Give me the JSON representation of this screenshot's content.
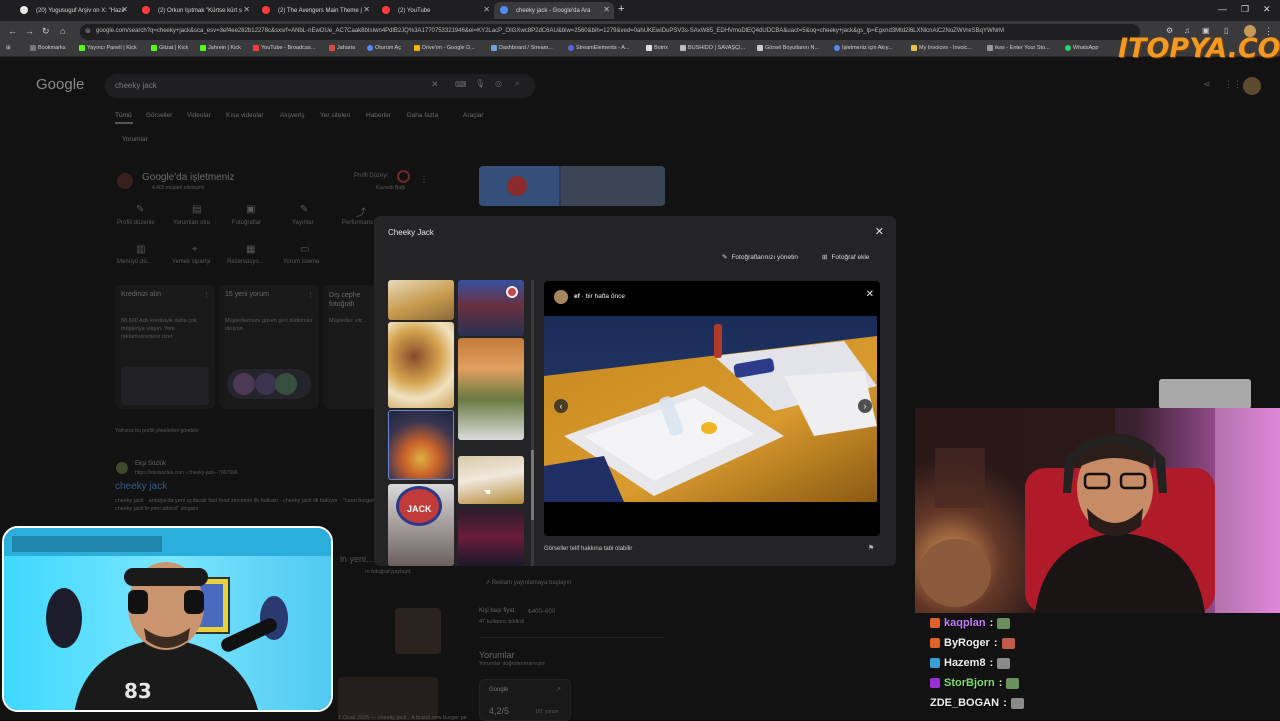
{
  "browser": {
    "tabs": [
      {
        "title": "(20) Yugusuguf Arşiv on X: \"Hazır",
        "color": "#e8e8e8"
      },
      {
        "title": "(2) Orkun Işıtmak \"Kürtse kürt s",
        "color": "#ff3b3b"
      },
      {
        "title": "(2) The Avengers Main Theme |",
        "color": "#ff3b3b"
      },
      {
        "title": "(2) YouTube",
        "color": "#ff3b3b"
      },
      {
        "title": "cheeky jack - Google'da Ara",
        "color": "#4f8df5",
        "active": true
      }
    ],
    "new_tab": "+",
    "url": "google.com/search?q=cheeky+jack&sca_esv=3ef4ee282b12278c&sxsrf=ANbL-nEwOUe_AC7Caak8bIsIwn4PdlB2JQ%3A1770753321946&ei=KY2LacP_OIGXwc8P2dC6AU&biw=2560&bih=1279&ved=0ahUKEwiDuPSV3s-SAxW85_EDHVmoDlEQ4dUDCBA&uact=5&oq=cheeky+jack&gs_lp=Egxnd3Mtd2l6LXNlcnAiC2NoZWVreSBqYWNrM",
    "bookmarks": [
      "Bookmarks",
      "Yayıncı Paneli | Kick",
      "Gitzat | Kick",
      "Jahrein | Kick",
      "YouTube - Broadcas...",
      "Jaharia",
      "Oturum Aç",
      "Drive'ım - Google D...",
      "Dashboard / Stream...",
      "StreamElements - A...",
      "Botrix",
      "BUSHIDO | SAVAŞÇI...",
      "Görsel Boyutlarını N...",
      "İşletmeniz için Akıy...",
      "My Invoices - Invoic...",
      "ikas - Enter Your Sto...",
      "WhatsApp"
    ]
  },
  "overlay_logo": "ITOPYA.COM",
  "google": {
    "logo": "Google",
    "query": "cheeky jack",
    "tabs": [
      "Tümü",
      "Görseller",
      "Videolar",
      "Kısa videolar",
      "Alışveriş",
      "Yer siteleri",
      "Haberler",
      "Daha fazla",
      "Araçlar"
    ],
    "filter_chip": "Yorumlar",
    "business_title": "Google'da işletmeniz",
    "business_sub": "4.405 müşteri etkileşimi",
    "profile_strength": "Profil Düzeyi",
    "profile_sub": "Kuvvetli Bağı",
    "actions": [
      "Profili düzenle",
      "Yorumları oku",
      "Fotoğraflar",
      "Yayınlar",
      "Performans",
      "Menüyü dü...",
      "Yemek siparişi",
      "Rezervasyo...",
      "Yorum isteme"
    ],
    "cards": [
      {
        "title": "Kredinizi alın",
        "body": "58.600 Ads kredisiyle daha çok müşteriye ulaşın. Yeni reklamverenlere özel"
      },
      {
        "title": "15 yeni yorum",
        "body": "Müşterilerinize güven geri bildirimler okuyun"
      },
      {
        "title": "Dış cephe fotoğrafı",
        "body": "Müşteriler vitr..."
      }
    ],
    "only_managers": "Yalnızca bu profili yöneticileri görebilir",
    "result_source": "Ekşi Sözlük",
    "result_url": "https://eksisozluk.com › cheeky-jack--7907996",
    "result_title": "cheeky jack",
    "result_snippet": "cheeky jack · antalya'da yeni açılacak fast food zincirinin ilk halkası · cheeky jack ilk bakıyor · \"cano burger cheeky jack'in yeni adresi\" sloganı",
    "result2_title": "in yeni...",
    "result2_snippet": "ın fotoğraf paylaşti.",
    "ad_line": "Reklam yayınlamaya başlayın",
    "price_label": "Kişi başı fiyat:",
    "price_value": "₺400–600",
    "price_sub": "47 kullanıcı bildirdi",
    "reviews_title": "Yorumlar",
    "reviews_sub": "Yorumlar doğrulanmamıştır",
    "review_source": "Google",
    "rating": "4,2/5",
    "rating_count": "101 yorum",
    "bottom_snippet": "1 Ocak 2025 — cheeky jack · A brand new burger pe"
  },
  "modal": {
    "title": "Cheeky Jack",
    "manage_photos": "Fotoğraflarınızı yönetin",
    "add_photo": "Fotoğraf ekle",
    "author": "ef",
    "time_ago": "bir hafta önce",
    "copyright_note": "Görseller telif hakkına tabi olabilir"
  },
  "chat": [
    {
      "user": "kaqplan",
      "color": "#c77dff",
      "badge": "#e0622a"
    },
    {
      "user": "ByRoger",
      "color": "#f1f1f1",
      "badge": "#e0622a"
    },
    {
      "user": "Hazem8",
      "color": "#f1f1f1",
      "badge": "#3aa0d8"
    },
    {
      "user": "StorBjorn",
      "color": "#7ee06a",
      "badge": "#9b2fd6"
    },
    {
      "user": "ZDE_BOGAN",
      "color": "#f1f1f1",
      "badge": null
    }
  ],
  "chat_sep": ":"
}
